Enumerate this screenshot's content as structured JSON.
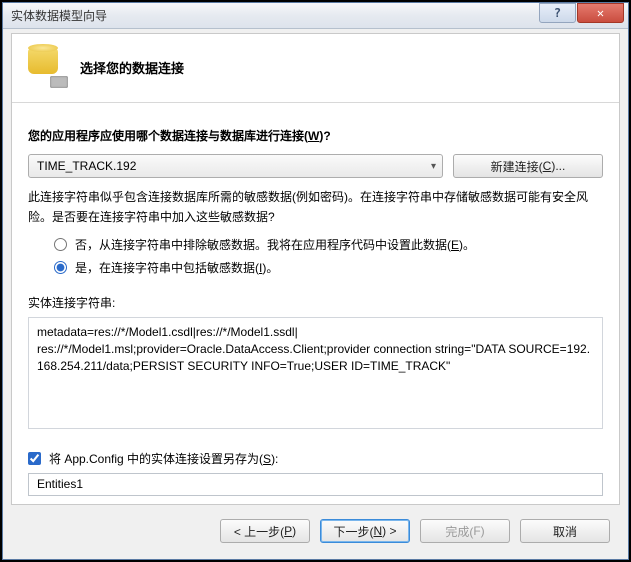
{
  "window": {
    "title": "实体数据模型向导"
  },
  "titlebar_buttons": {
    "help_glyph": "?",
    "close_glyph": "✕"
  },
  "header": {
    "title": "选择您的数据连接"
  },
  "prompt": {
    "label_pre": "您的应用程序应使用哪个数据连接与数据库进行连接(",
    "label_key": "W",
    "label_post": ")?"
  },
  "connection_select": {
    "value": "TIME_TRACK.192"
  },
  "new_connection_btn": {
    "label_pre": "新建连接(",
    "label_key": "C",
    "label_post": ")..."
  },
  "warning_text": "此连接字符串似乎包含连接数据库所需的敏感数据(例如密码)。在连接字符串中存储敏感数据可能有安全风险。是否要在连接字符串中加入这些敏感数据?",
  "radio": {
    "option_no": {
      "pre": "否，从连接字符串中排除敏感数据。我将在应用程序代码中设置此数据(",
      "key": "E",
      "post": ")。"
    },
    "option_yes": {
      "pre": "是，在连接字符串中包括敏感数据(",
      "key": "I",
      "post": ")。"
    },
    "selected": "yes"
  },
  "conn_string": {
    "label": "实体连接字符串:",
    "value": "metadata=res://*/Model1.csdl|res://*/Model1.ssdl|\nres://*/Model1.msl;provider=Oracle.DataAccess.Client;provider connection string=\"DATA SOURCE=192.168.254.211/data;PERSIST SECURITY INFO=True;USER ID=TIME_TRACK\""
  },
  "save_as": {
    "checked": true,
    "label_pre": "将 App.Config 中的实体连接设置另存为(",
    "label_key": "S",
    "label_post": "):",
    "value": "Entities1"
  },
  "footer": {
    "back": {
      "pre": "< 上一步(",
      "key": "P",
      "post": ")"
    },
    "next": {
      "pre": "下一步(",
      "key": "N",
      "post": ") >"
    },
    "finish": {
      "pre": "完成(",
      "key": "F",
      "post": ")"
    },
    "cancel": "取消"
  }
}
